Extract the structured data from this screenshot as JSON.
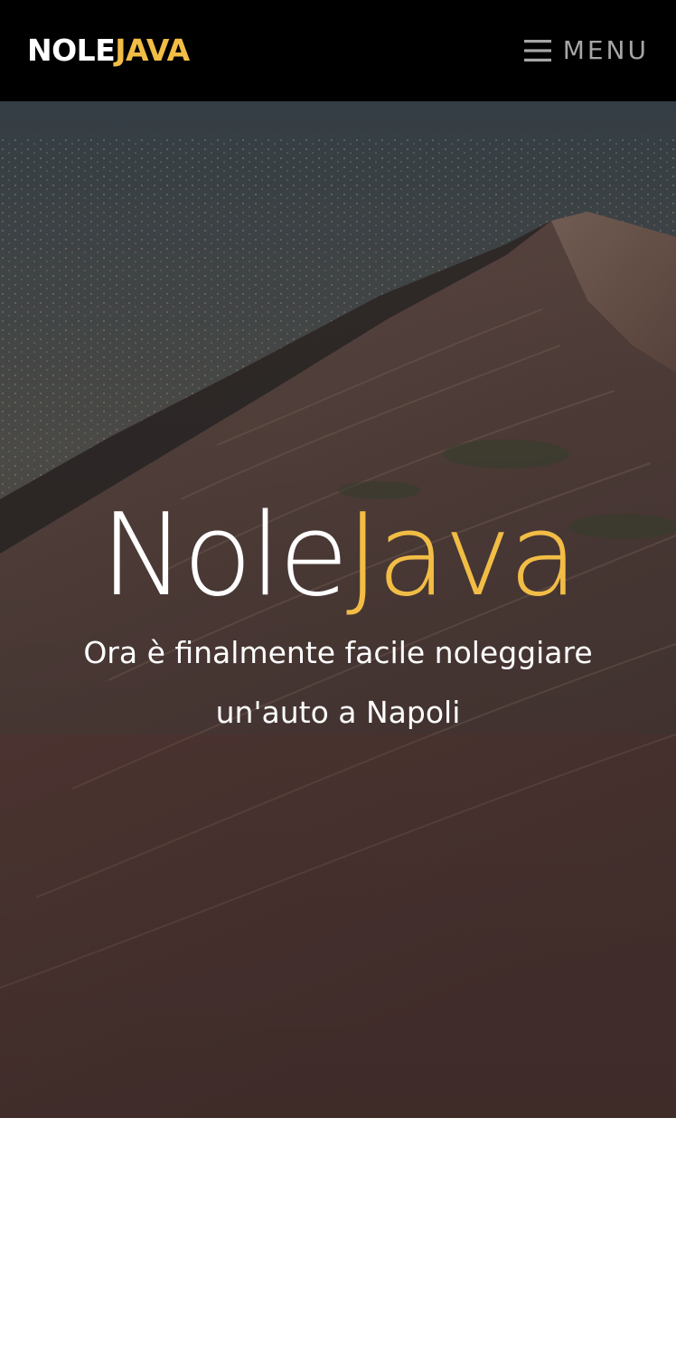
{
  "header": {
    "logo_part1": "NOLE",
    "logo_part2": "JAVA",
    "menu_icon": "hamburger-icon",
    "menu_label": "MENU"
  },
  "hero": {
    "background": "volcano-slope-photo",
    "title_part1": "Nole",
    "title_part2": "Java",
    "subtitle": "Ora è finalmente facile noleggiare un'auto a Napoli"
  },
  "colors": {
    "accent": "#f2bd45",
    "header_bg": "#000000",
    "menu_text": "#a6a6a6",
    "page_bg": "#ffffff"
  }
}
